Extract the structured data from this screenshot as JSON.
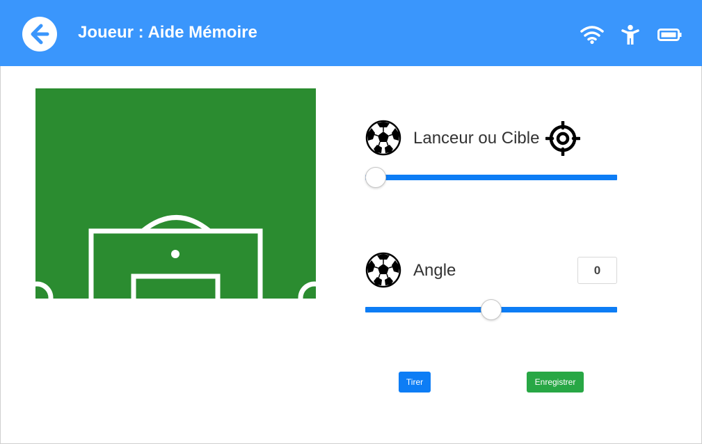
{
  "header": {
    "title": "Joueur : Aide Mémoire",
    "back_icon": "arrow-left-icon",
    "status_icons": [
      "wifi-icon",
      "person-icon",
      "battery-icon"
    ],
    "background_color": "#3a96fc"
  },
  "pitch": {
    "background_color": "#2b8c30",
    "line_color": "#ffffff"
  },
  "launcher": {
    "label": "Lanceur ou Cible",
    "ball_icon": "soccer-ball-icon",
    "target_icon": "crosshair-icon",
    "slider_fraction": 0.0
  },
  "angle": {
    "label": "Angle",
    "value": "0",
    "ball_icon": "soccer-ball-icon",
    "slider_fraction": 0.5
  },
  "buttons": {
    "shoot_label": "Tirer",
    "save_label": "Enregistrer"
  },
  "colors": {
    "accent": "#0d7df5",
    "success": "#28a745"
  }
}
